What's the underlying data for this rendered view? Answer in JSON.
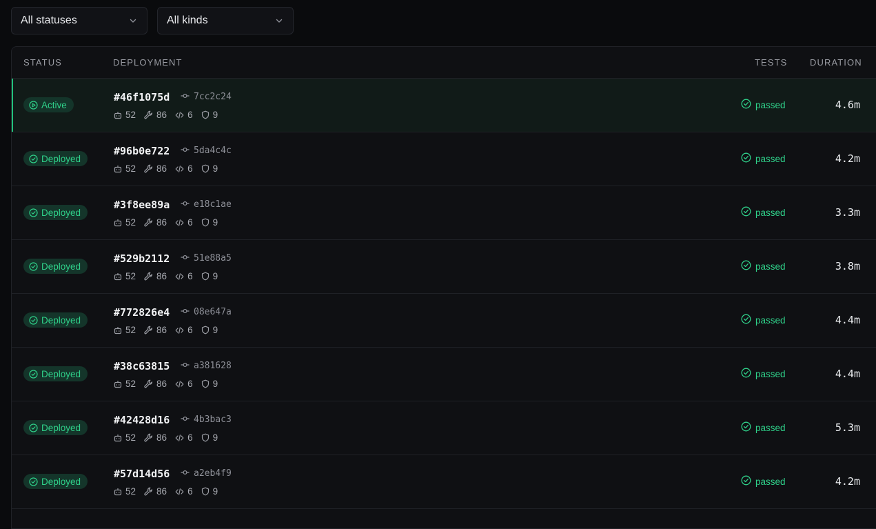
{
  "filters": {
    "status": {
      "label": "All statuses"
    },
    "kind": {
      "label": "All kinds"
    }
  },
  "columns": {
    "status": "STATUS",
    "deployment": "DEPLOYMENT",
    "tests": "TESTS",
    "duration": "DURATION"
  },
  "colors": {
    "accent": "#2fd18a",
    "background": "#0a0b0d",
    "panel": "#0f1013"
  },
  "rows": [
    {
      "status": "Active",
      "active": true,
      "id": "#46f1075d",
      "commit": "7cc2c24",
      "stats": {
        "robots": "52",
        "tools": "86",
        "code": "6",
        "shield": "9"
      },
      "tests": "passed",
      "duration": "4.6m"
    },
    {
      "status": "Deployed",
      "active": false,
      "id": "#96b0e722",
      "commit": "5da4c4c",
      "stats": {
        "robots": "52",
        "tools": "86",
        "code": "6",
        "shield": "9"
      },
      "tests": "passed",
      "duration": "4.2m"
    },
    {
      "status": "Deployed",
      "active": false,
      "id": "#3f8ee89a",
      "commit": "e18c1ae",
      "stats": {
        "robots": "52",
        "tools": "86",
        "code": "6",
        "shield": "9"
      },
      "tests": "passed",
      "duration": "3.3m"
    },
    {
      "status": "Deployed",
      "active": false,
      "id": "#529b2112",
      "commit": "51e88a5",
      "stats": {
        "robots": "52",
        "tools": "86",
        "code": "6",
        "shield": "9"
      },
      "tests": "passed",
      "duration": "3.8m"
    },
    {
      "status": "Deployed",
      "active": false,
      "id": "#772826e4",
      "commit": "08e647a",
      "stats": {
        "robots": "52",
        "tools": "86",
        "code": "6",
        "shield": "9"
      },
      "tests": "passed",
      "duration": "4.4m"
    },
    {
      "status": "Deployed",
      "active": false,
      "id": "#38c63815",
      "commit": "a381628",
      "stats": {
        "robots": "52",
        "tools": "86",
        "code": "6",
        "shield": "9"
      },
      "tests": "passed",
      "duration": "4.4m"
    },
    {
      "status": "Deployed",
      "active": false,
      "id": "#42428d16",
      "commit": "4b3bac3",
      "stats": {
        "robots": "52",
        "tools": "86",
        "code": "6",
        "shield": "9"
      },
      "tests": "passed",
      "duration": "5.3m"
    },
    {
      "status": "Deployed",
      "active": false,
      "id": "#57d14d56",
      "commit": "a2eb4f9",
      "stats": {
        "robots": "52",
        "tools": "86",
        "code": "6",
        "shield": "9"
      },
      "tests": "passed",
      "duration": "4.2m"
    }
  ]
}
